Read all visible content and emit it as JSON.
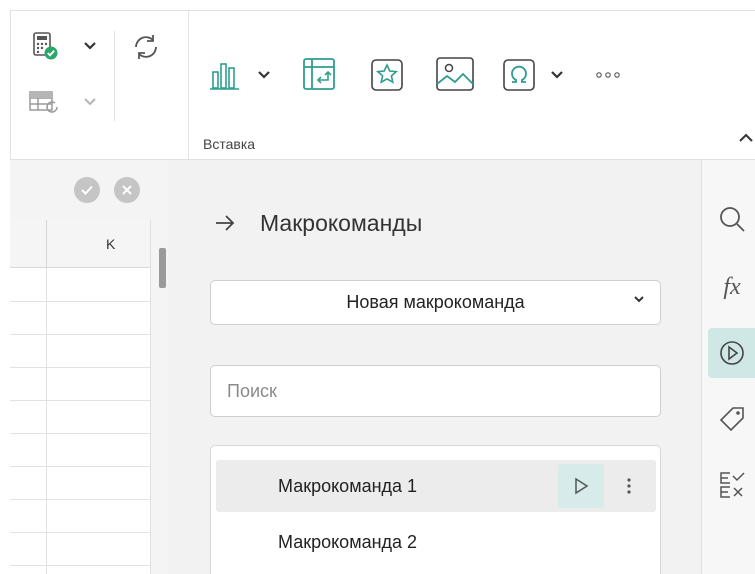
{
  "ribbon": {
    "group_label": "Вставка"
  },
  "grid": {
    "column_label": "K"
  },
  "panel": {
    "title": "Макрокоманды",
    "select_value": "Новая макрокоманда",
    "search_placeholder": "Поиск",
    "macros": [
      {
        "label": "Макрокоманда 1"
      },
      {
        "label": "Макрокоманда 2"
      }
    ]
  },
  "colors": {
    "accent": "#2e9e8f",
    "active_bg": "#cfe8e6",
    "panel_bg": "#f2f2f2"
  },
  "icons": {
    "ribbon": [
      "calculator-check-icon",
      "table-refresh-icon",
      "refresh-icon",
      "bar-chart-icon",
      "pivot-table-icon",
      "star-icon",
      "image-icon",
      "omega-icon",
      "more-icon",
      "chevron-up-icon"
    ],
    "sidebar": [
      "search-icon",
      "function-icon",
      "macro-icon",
      "tag-icon",
      "compare-icon"
    ]
  }
}
